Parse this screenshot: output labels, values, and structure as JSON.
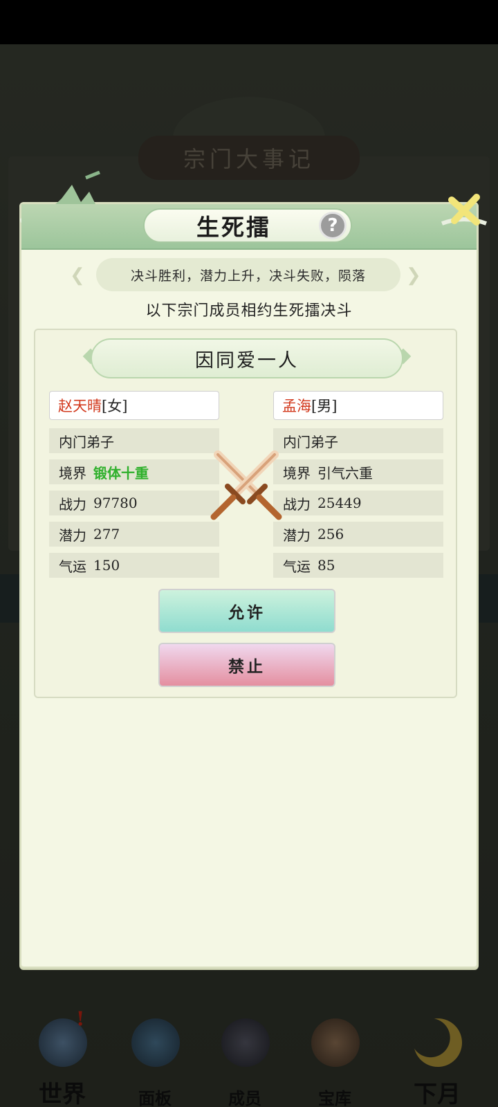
{
  "background": {
    "title": "宗门大事记"
  },
  "bottom_nav": [
    {
      "label": "世界",
      "icon": "palace-icon",
      "badge": "!"
    },
    {
      "label": "面板",
      "icon": "temple-gate-icon"
    },
    {
      "label": "成员",
      "icon": "disciple-icon"
    },
    {
      "label": "宝库",
      "icon": "treasury-icon"
    },
    {
      "label": "下月",
      "icon": "moon-icon"
    }
  ],
  "modal": {
    "title": "生死擂",
    "help_icon": "?",
    "rule": "决斗胜利，潜力上升，决斗失败，陨落",
    "subheading": "以下宗门成员相约生死擂决斗",
    "reason": "因同爱一人",
    "left": {
      "name": "赵天晴",
      "gender": "[女]",
      "rank": "内门弟子",
      "realm_label": "境界",
      "realm": "锻体十重",
      "power_label": "战力",
      "power": "97780",
      "potential_label": "潜力",
      "potential": "277",
      "luck_label": "气运",
      "luck": "150"
    },
    "right": {
      "name": "孟海",
      "gender": "[男]",
      "rank": "内门弟子",
      "realm_label": "境界",
      "realm": "引气六重",
      "power_label": "战力",
      "power": "25449",
      "potential_label": "潜力",
      "potential": "256",
      "luck_label": "气运",
      "luck": "85"
    },
    "allow_label": "允许",
    "deny_label": "禁止"
  },
  "colors": {
    "header_green": "#9cc59b",
    "name_red": "#d2381c",
    "realm_green": "#2fb02c",
    "allow_teal": "#8fdccf",
    "deny_pink": "#e48fa0"
  }
}
